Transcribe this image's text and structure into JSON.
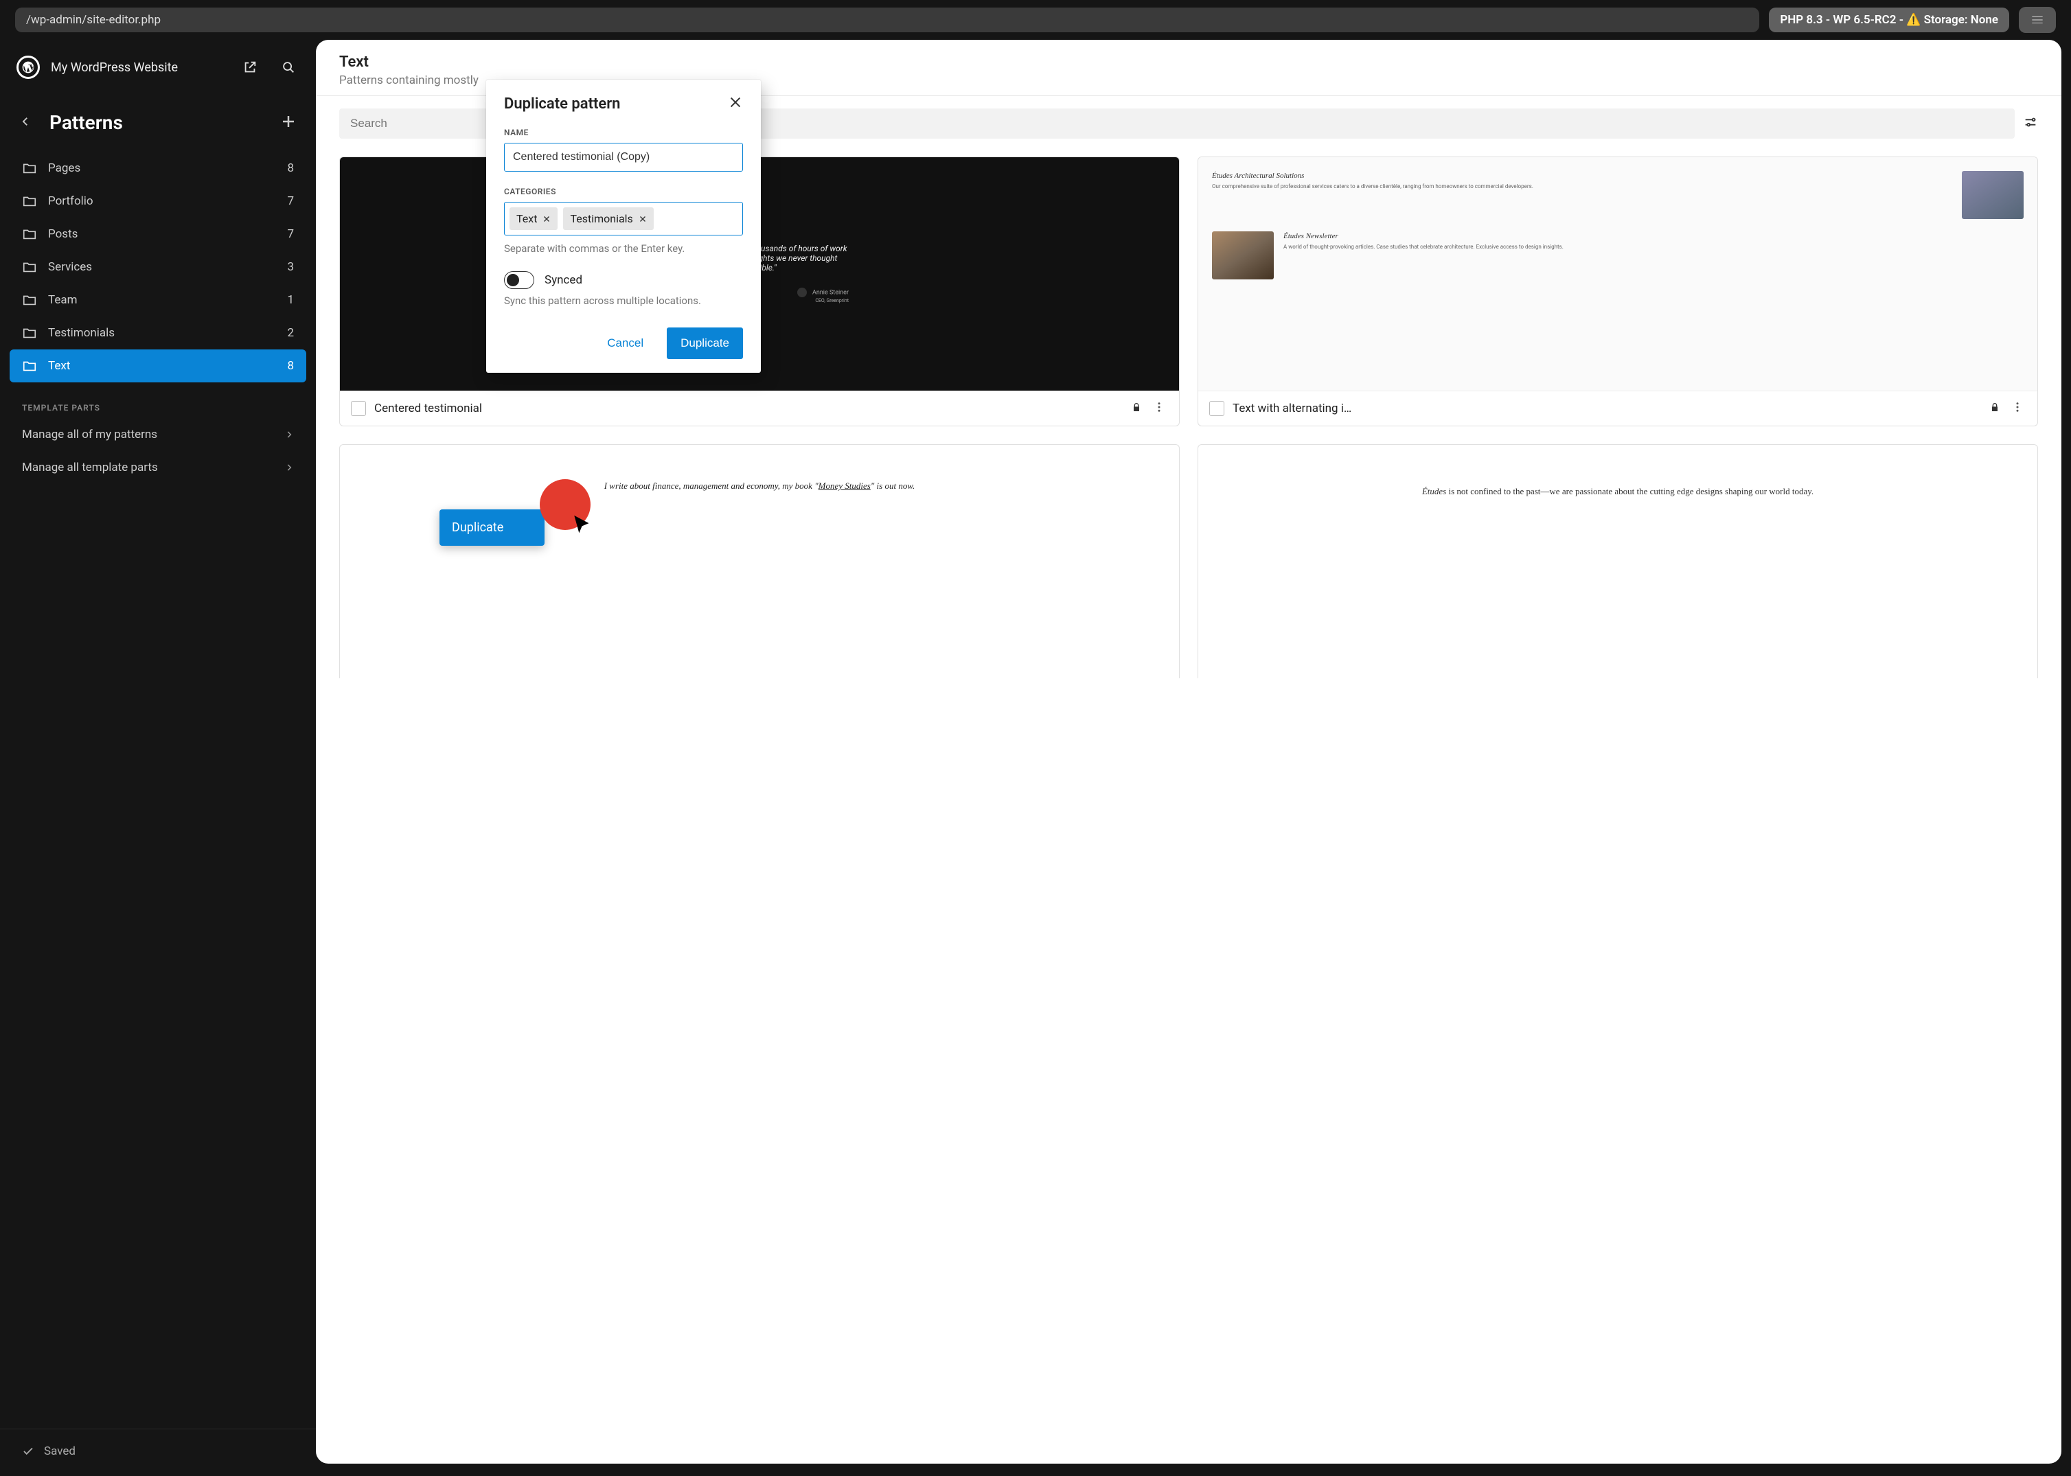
{
  "topbar": {
    "url": "/wp-admin/site-editor.php",
    "env": "PHP 8.3 - WP 6.5-RC2 - ⚠️ Storage: None"
  },
  "sidebar": {
    "site_title": "My WordPress Website",
    "section_title": "Patterns",
    "categories": [
      {
        "label": "Pages",
        "count": "8",
        "active": false
      },
      {
        "label": "Portfolio",
        "count": "7",
        "active": false
      },
      {
        "label": "Posts",
        "count": "7",
        "active": false
      },
      {
        "label": "Services",
        "count": "3",
        "active": false
      },
      {
        "label": "Team",
        "count": "1",
        "active": false
      },
      {
        "label": "Testimonials",
        "count": "2",
        "active": false
      },
      {
        "label": "Text",
        "count": "8",
        "active": true
      }
    ],
    "template_parts_heading": "TEMPLATE PARTS",
    "manage_patterns": "Manage all of my patterns",
    "manage_template_parts": "Manage all template parts",
    "saved_label": "Saved"
  },
  "panel": {
    "title": "Text",
    "subtitle": "Patterns containing mostly",
    "search_placeholder": "Search"
  },
  "cards": {
    "c1": {
      "title": "Centered testimonial",
      "quote": "\"Études has saved us thousands of hours of work and has unlocked insights we never thought possible.\"",
      "attr_name": "Annie Steiner",
      "attr_role": "CEO, Greenprint"
    },
    "c2": {
      "title": "Text with alternating i…",
      "alt_head1": "Études Architectural Solutions",
      "alt_head2": "Études Newsletter",
      "alt_txt1": "Our comprehensive suite of professional services caters to a diverse clientèle, ranging from homeowners to commercial developers.",
      "alt_txt2": "A world of thought-provoking articles. Case studies that celebrate architecture. Exclusive access to design insights."
    },
    "c3": {
      "text_a": "I write about finance, management and economy, my book \"",
      "text_link": "Money Studies",
      "text_b": "\" is out now."
    },
    "c4": {
      "text_a": "Études",
      "text_b": " is not confined to the past—we are passionate about the cutting edge designs shaping our world today."
    }
  },
  "popover": {
    "duplicate": "Duplicate"
  },
  "modal": {
    "title": "Duplicate pattern",
    "name_label": "NAME",
    "name_value": "Centered testimonial (Copy)",
    "cats_label": "CATEGORIES",
    "tags": [
      "Text",
      "Testimonials"
    ],
    "cats_help": "Separate with commas or the Enter key.",
    "toggle_label": "Synced",
    "toggle_help": "Sync this pattern across multiple locations.",
    "cancel": "Cancel",
    "confirm": "Duplicate"
  }
}
